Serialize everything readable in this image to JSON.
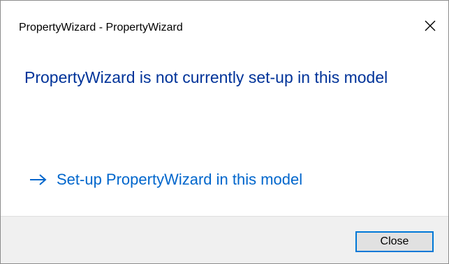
{
  "window": {
    "title": "PropertyWizard - PropertyWizard"
  },
  "content": {
    "main_instruction": "PropertyWizard is not currently set-up in this model",
    "command_link_label": "Set-up PropertyWizard in this model"
  },
  "footer": {
    "close_label": "Close"
  },
  "icons": {
    "close": "close-icon",
    "command_arrow": "arrow-right-icon"
  },
  "colors": {
    "instruction": "#003399",
    "link": "#0066cc",
    "button_border": "#0078d7",
    "footer_bg": "#f0f0f0"
  }
}
